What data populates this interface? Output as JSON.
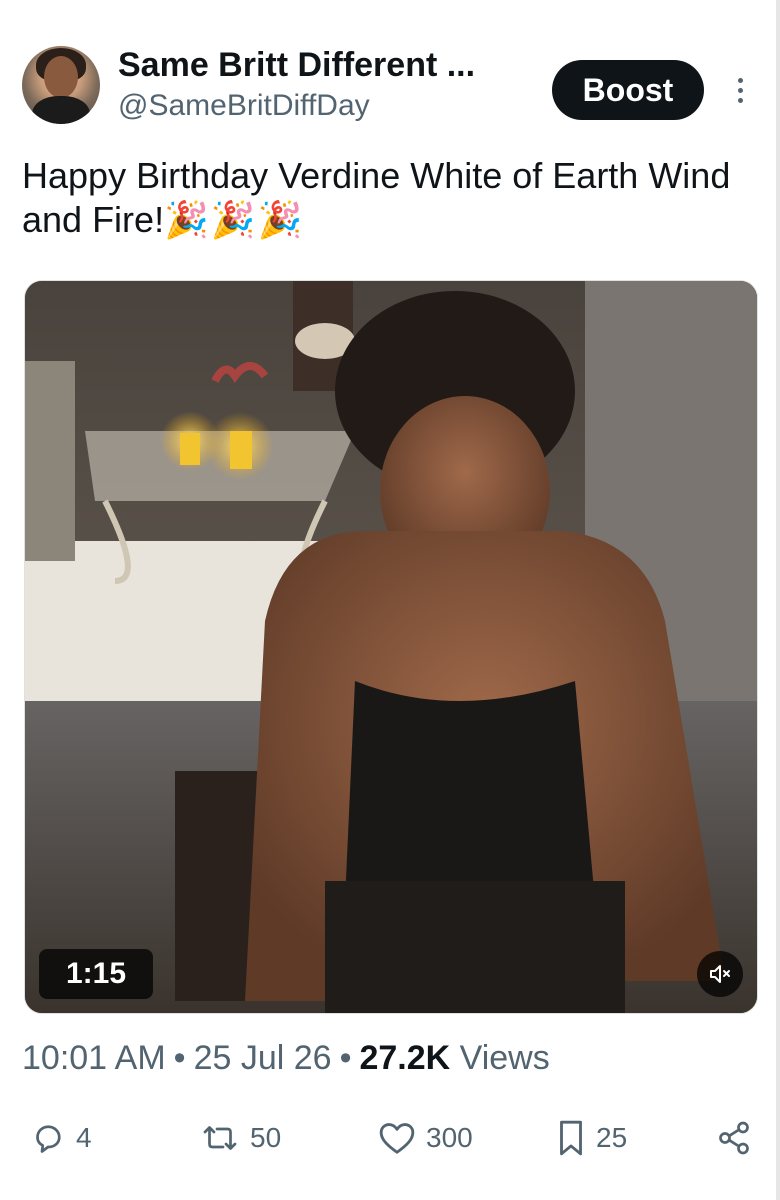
{
  "author": {
    "display_name": "Same Britt Different ...",
    "handle": "@SameBritDiffDay",
    "avatar_icon": "profile-photo"
  },
  "header": {
    "boost_label": "Boost",
    "more_icon": "more-vertical-icon"
  },
  "tweet": {
    "text": "Happy Birthday Verdine White of Earth Wind and Fire!",
    "emojis": "🎉🎉🎉"
  },
  "video": {
    "duration": "1:15",
    "mute_icon": "mute-icon"
  },
  "meta": {
    "time": "10:01 AM",
    "date": "25 Jul 26",
    "views_count": "27.2K",
    "views_label": "Views"
  },
  "actions": {
    "replies": "4",
    "reposts": "50",
    "likes": "300",
    "bookmarks": "25"
  },
  "colors": {
    "text_primary": "#0f1419",
    "text_secondary": "#536471",
    "button_bg": "#0f1419",
    "background": "#ffffff"
  }
}
